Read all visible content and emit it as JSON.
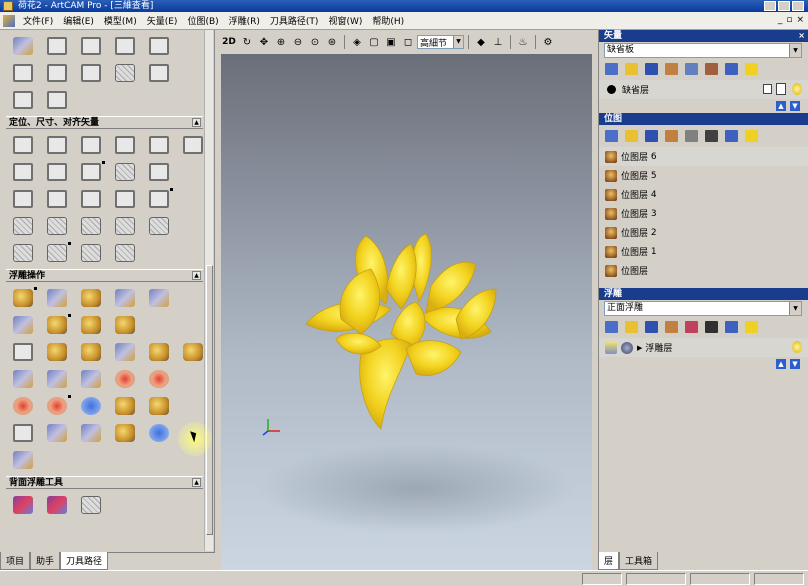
{
  "window": {
    "title": "荷花2 - ArtCAM Pro - [三維查看]"
  },
  "menu": [
    "文件(F)",
    "编辑(E)",
    "模型(M)",
    "矢量(E)",
    "位图(B)",
    "浮雕(R)",
    "刀具路径(T)",
    "视窗(W)",
    "帮助(H)"
  ],
  "left_panel": {
    "sections": [
      {
        "title": "定位、尺寸、对齐矢量"
      },
      {
        "title": "浮雕操作"
      },
      {
        "title": "背面浮雕工具"
      }
    ],
    "tabs": [
      "项目",
      "助手",
      "刀具路径"
    ],
    "active_tab": "刀具路径"
  },
  "viewport": {
    "mode_label": "2D",
    "detail_select": "高細节"
  },
  "vector_panel": {
    "title": "矢量",
    "select_value": "缺省板",
    "layers": [
      {
        "name": "缺省层"
      }
    ]
  },
  "bitmap_panel": {
    "title": "位图",
    "layers": [
      {
        "name": "位图层",
        "num": "6"
      },
      {
        "name": "位图层",
        "num": "5"
      },
      {
        "name": "位图层",
        "num": "4"
      },
      {
        "name": "位图层",
        "num": "3"
      },
      {
        "name": "位图层",
        "num": "2"
      },
      {
        "name": "位图层",
        "num": "1"
      },
      {
        "name": "位图层",
        "num": ""
      }
    ]
  },
  "relief_panel": {
    "title": "浮雕",
    "select_value": "正面浮雕",
    "layers": [
      {
        "name": "浮雕层"
      }
    ]
  },
  "right_tabs": [
    "层",
    "工具箱"
  ],
  "colors": {
    "flower": "#f2d21e",
    "panel_header": "#1a3c8c"
  }
}
